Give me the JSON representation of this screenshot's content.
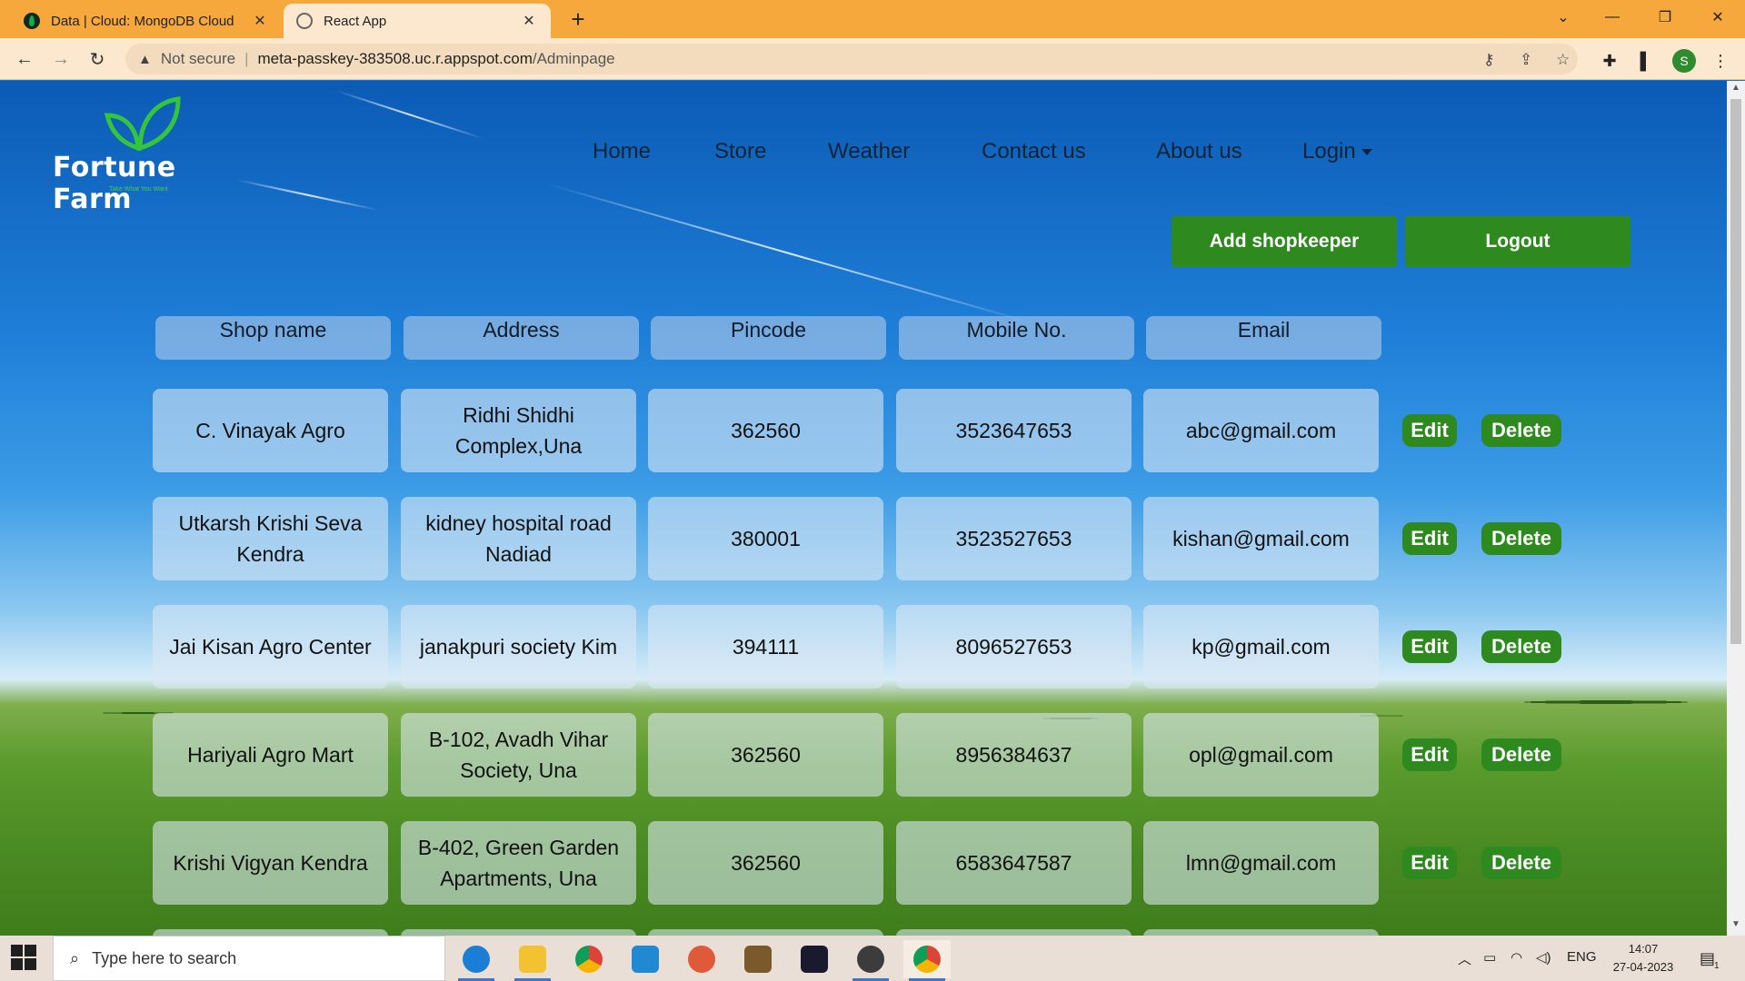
{
  "browser": {
    "tabs": [
      {
        "title": "Data | Cloud: MongoDB Cloud",
        "close": "✕",
        "icon": "mongodb-leaf-icon",
        "active": false
      },
      {
        "title": "React App",
        "close": "✕",
        "icon": "globe-icon",
        "active": true
      }
    ],
    "new_tab": "+",
    "address": {
      "security_label": "Not secure",
      "host": "meta-passkey-383508.uc.r.appspot.com",
      "path": "/Adminpage"
    },
    "profile_initial": "S"
  },
  "site": {
    "brand": "Fortune Farm",
    "tagline": "Take What You Want",
    "nav": [
      "Home",
      "Store",
      "Weather",
      "Contact us",
      "About us"
    ],
    "login_label": "Login",
    "add_button": "Add shopkeeper",
    "logout_button": "Logout"
  },
  "table": {
    "headers": [
      "Shop name",
      "Address",
      "Pincode",
      "Mobile No.",
      "Email"
    ],
    "rows": [
      {
        "shop": "C. Vinayak Agro",
        "address": "Ridhi Shidhi Complex,Una",
        "pincode": "362560",
        "mobile": "3523647653",
        "email": "abc@gmail.com"
      },
      {
        "shop": "Utkarsh Krishi Seva Kendra",
        "address": "kidney hospital road Nadiad",
        "pincode": "380001",
        "mobile": "3523527653",
        "email": "kishan@gmail.com"
      },
      {
        "shop": "Jai Kisan Agro Center",
        "address": "janakpuri society Kim",
        "pincode": "394111",
        "mobile": "8096527653",
        "email": "kp@gmail.com"
      },
      {
        "shop": "Hariyali Agro Mart",
        "address": "B-102, Avadh Vihar Society, Una",
        "pincode": "362560",
        "mobile": "8956384637",
        "email": "opl@gmail.com"
      },
      {
        "shop": "Krishi Vigyan Kendra",
        "address": "B-402, Green Garden Apartments, Una",
        "pincode": "362560",
        "mobile": "6583647587",
        "email": "lmn@gmail.com"
      }
    ],
    "edit_label": "Edit",
    "delete_label": "Delete"
  },
  "taskbar": {
    "search_placeholder": "Type here to search",
    "language": "ENG",
    "time": "14:07",
    "date": "27-04-2023",
    "notification_count": "1"
  },
  "colors": {
    "tabstrip": "#f6a83c",
    "toolbar": "#fbe8cf",
    "button_green": "#2e8a1e",
    "brand_green": "#42d04a"
  }
}
